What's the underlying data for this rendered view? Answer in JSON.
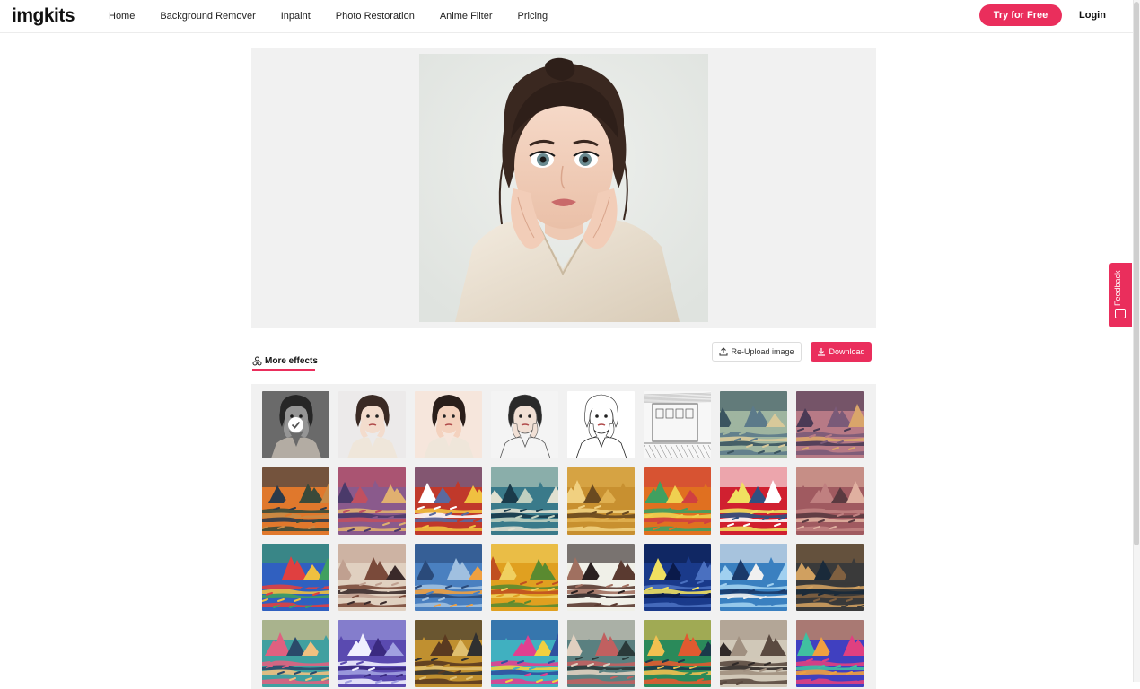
{
  "header": {
    "logo": "imgkits",
    "nav": [
      "Home",
      "Background Remover",
      "Inpaint",
      "Photo Restoration",
      "Anime Filter",
      "Pricing"
    ],
    "try_label": "Try for Free",
    "login_label": "Login"
  },
  "feedback_label": "Feedback",
  "actions": {
    "more_effects_label": "More effects",
    "reupload_label": "Re-Upload image",
    "download_label": "Download"
  },
  "colors": {
    "accent": "#ea2e5c",
    "panel": "#f1f1f1"
  },
  "effects": [
    {
      "kind": "photo-gray",
      "selected": true
    },
    {
      "kind": "photo-anime"
    },
    {
      "kind": "photo-warm"
    },
    {
      "kind": "photo-sketch-color"
    },
    {
      "kind": "photo-lineart"
    },
    {
      "kind": "sketch-train"
    },
    {
      "kind": "art",
      "palette": [
        "#9fb5a0",
        "#5c7a8a",
        "#d8c99a",
        "#3b5560"
      ]
    },
    {
      "kind": "art",
      "palette": [
        "#b77a86",
        "#7a5a78",
        "#d9a56a",
        "#4a3a55"
      ]
    },
    {
      "kind": "art",
      "palette": [
        "#e0782c",
        "#3a4a3a",
        "#c98a45",
        "#2c3a4a"
      ]
    },
    {
      "kind": "art",
      "palette": [
        "#8a5a8c",
        "#e0b070",
        "#4a3a6a",
        "#c05060"
      ]
    },
    {
      "kind": "art",
      "palette": [
        "#c0392b",
        "#f0c040",
        "#ffffff",
        "#5a6aa0"
      ]
    },
    {
      "kind": "art",
      "palette": [
        "#3a7a8a",
        "#e0e0d0",
        "#1a3a4a",
        "#c0d0c0"
      ]
    },
    {
      "kind": "art",
      "palette": [
        "#c89030",
        "#f0d080",
        "#6a4a20",
        "#e0b050"
      ]
    },
    {
      "kind": "art",
      "palette": [
        "#e07020",
        "#40a060",
        "#f0d050",
        "#d04040"
      ]
    },
    {
      "kind": "art",
      "palette": [
        "#d02030",
        "#f0e060",
        "#305080",
        "#ffffff"
      ]
    },
    {
      "kind": "art",
      "palette": [
        "#a05a60",
        "#c08080",
        "#5a3a40",
        "#e0b0a0"
      ]
    },
    {
      "kind": "art",
      "palette": [
        "#3060c0",
        "#e04040",
        "#f0c040",
        "#40a060"
      ]
    },
    {
      "kind": "art",
      "palette": [
        "#e0d0c0",
        "#7a4a3a",
        "#3a2a2a",
        "#c0a090"
      ]
    },
    {
      "kind": "art",
      "palette": [
        "#4a80c0",
        "#a0c0e0",
        "#f0a040",
        "#2a4a7a"
      ]
    },
    {
      "kind": "art",
      "palette": [
        "#e0a020",
        "#5a8a30",
        "#c05020",
        "#f0d060"
      ]
    },
    {
      "kind": "art",
      "palette": [
        "#f0f0e8",
        "#5a3a30",
        "#a07060",
        "#2a2020"
      ]
    },
    {
      "kind": "art",
      "palette": [
        "#1a3a8a",
        "#4a70c0",
        "#f0e060",
        "#0a1a4a"
      ]
    },
    {
      "kind": "art",
      "palette": [
        "#3a80c0",
        "#a0d0f0",
        "#1a3a6a",
        "#f0f0f0"
      ]
    },
    {
      "kind": "art",
      "palette": [
        "#3a3a3a",
        "#d0a060",
        "#1a2a3a",
        "#806040"
      ]
    },
    {
      "kind": "art",
      "palette": [
        "#40a0a0",
        "#e06080",
        "#2a4a6a",
        "#f0c080"
      ]
    },
    {
      "kind": "art",
      "palette": [
        "#5a4ab0",
        "#f0f0ff",
        "#3a2a80",
        "#a0a0e0"
      ]
    },
    {
      "kind": "art",
      "palette": [
        "#c09030",
        "#5a3a20",
        "#e0c070",
        "#303030"
      ]
    },
    {
      "kind": "art",
      "palette": [
        "#40b0c0",
        "#e04090",
        "#f0d040",
        "#3050a0"
      ]
    },
    {
      "kind": "art",
      "palette": [
        "#5a8080",
        "#c06060",
        "#2a3a3a",
        "#e0d0c0"
      ]
    },
    {
      "kind": "art",
      "palette": [
        "#2a8a5a",
        "#e05a30",
        "#1a3a4a",
        "#f0c050"
      ]
    },
    {
      "kind": "art",
      "palette": [
        "#d0c8b8",
        "#5a4a40",
        "#302a28",
        "#a09080"
      ]
    },
    {
      "kind": "art",
      "palette": [
        "#4040c0",
        "#e04080",
        "#40c0a0",
        "#f0a040"
      ]
    }
  ]
}
